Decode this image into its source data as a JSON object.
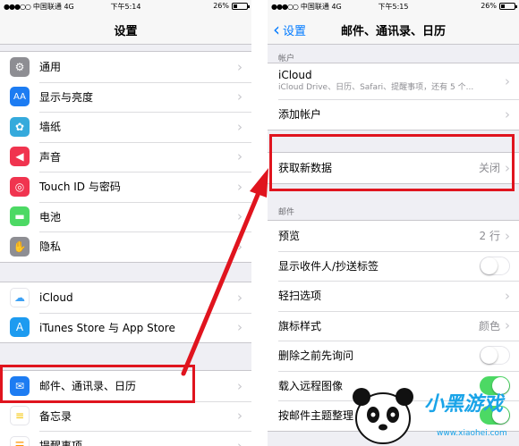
{
  "left_screen": {
    "status": {
      "carrier": "中国联通",
      "network": "4G",
      "time": "下午5:14",
      "battery": "26%"
    },
    "nav_title": "设置",
    "group1": [
      {
        "icon": "gear-icon",
        "label": "通用",
        "color": "#8e8e93"
      },
      {
        "icon": "display-brightness-icon",
        "label": "显示与亮度",
        "color": "#1d7cf2"
      },
      {
        "icon": "wallpaper-icon",
        "label": "墙纸",
        "color": "#35aadc"
      },
      {
        "icon": "sound-icon",
        "label": "声音",
        "color": "#f0344f"
      },
      {
        "icon": "fingerprint-icon",
        "label": "Touch ID 与密码",
        "color": "#f0344f"
      },
      {
        "icon": "battery-icon",
        "label": "电池",
        "color": "#4cd964"
      },
      {
        "icon": "privacy-hand-icon",
        "label": "隐私",
        "color": "#8e8e93"
      }
    ],
    "group2": [
      {
        "icon": "icloud-icon",
        "label": "iCloud",
        "color": "#ffffff"
      },
      {
        "icon": "app-store-icon",
        "label": "iTunes Store 与 App Store",
        "color": "#1d9bf0"
      }
    ],
    "group3": [
      {
        "icon": "mail-icon",
        "label": "邮件、通讯录、日历",
        "color": "#1d7cf2"
      },
      {
        "icon": "notes-icon",
        "label": "备忘录",
        "color": "#ffffff"
      },
      {
        "icon": "reminders-icon",
        "label": "提醒事项",
        "color": "#ffffff"
      }
    ]
  },
  "right_screen": {
    "status": {
      "carrier": "中国联通",
      "network": "4G",
      "time": "下午5:15",
      "battery": "26%"
    },
    "nav_back": "设置",
    "nav_title": "邮件、通讯录、日历",
    "accounts_header": "帐户",
    "icloud_title": "iCloud",
    "icloud_subtitle": "iCloud Drive、日历、Safari、提醒事项，还有 5 个...",
    "add_account": "添加帐户",
    "fetch_label": "获取新数据",
    "fetch_value": "关闭",
    "mail_header": "邮件",
    "mail_rows": [
      {
        "label": "预览",
        "value": "2 行",
        "type": "value"
      },
      {
        "label": "显示收件人/抄送标签",
        "type": "toggle",
        "on": false
      },
      {
        "label": "轻扫选项",
        "type": "chevron"
      },
      {
        "label": "旗标样式",
        "value": "颜色",
        "type": "value"
      },
      {
        "label": "删除之前先询问",
        "type": "toggle",
        "on": false
      },
      {
        "label": "载入远程图像",
        "type": "toggle",
        "on": true
      },
      {
        "label": "按邮件主题整理",
        "type": "toggle",
        "on": true
      }
    ]
  },
  "annotation_color": "#e0141e",
  "watermark": {
    "name": "小黑游戏",
    "url": "www.xiaohei.com"
  }
}
